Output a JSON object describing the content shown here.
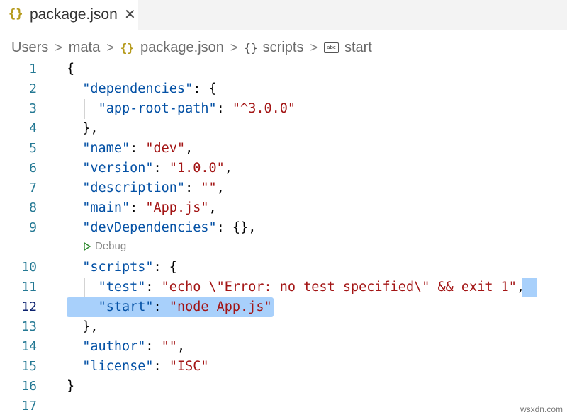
{
  "tab": {
    "label": "package.json",
    "icon": "json-braces-icon"
  },
  "breadcrumb": {
    "items": [
      "Users",
      "mata",
      "package.json",
      "scripts",
      "start"
    ]
  },
  "codelens": {
    "label": "Debug"
  },
  "lines": [
    {
      "num": "1",
      "segments": [
        [
          "p",
          "{"
        ]
      ]
    },
    {
      "num": "2",
      "segments": [
        [
          "p",
          "  "
        ],
        [
          "k",
          "\"dependencies\""
        ],
        [
          "p",
          ": {"
        ]
      ]
    },
    {
      "num": "3",
      "segments": [
        [
          "p",
          "    "
        ],
        [
          "k",
          "\"app-root-path\""
        ],
        [
          "p",
          ": "
        ],
        [
          "s",
          "\"^3.0.0\""
        ]
      ]
    },
    {
      "num": "4",
      "segments": [
        [
          "p",
          "  },"
        ]
      ]
    },
    {
      "num": "5",
      "segments": [
        [
          "p",
          "  "
        ],
        [
          "k",
          "\"name\""
        ],
        [
          "p",
          ": "
        ],
        [
          "s",
          "\"dev\""
        ],
        [
          "p",
          ","
        ]
      ]
    },
    {
      "num": "6",
      "segments": [
        [
          "p",
          "  "
        ],
        [
          "k",
          "\"version\""
        ],
        [
          "p",
          ": "
        ],
        [
          "s",
          "\"1.0.0\""
        ],
        [
          "p",
          ","
        ]
      ]
    },
    {
      "num": "7",
      "segments": [
        [
          "p",
          "  "
        ],
        [
          "k",
          "\"description\""
        ],
        [
          "p",
          ": "
        ],
        [
          "s",
          "\"\""
        ],
        [
          "p",
          ","
        ]
      ]
    },
    {
      "num": "8",
      "segments": [
        [
          "p",
          "  "
        ],
        [
          "k",
          "\"main\""
        ],
        [
          "p",
          ": "
        ],
        [
          "s",
          "\"App.js\""
        ],
        [
          "p",
          ","
        ]
      ]
    },
    {
      "num": "9",
      "segments": [
        [
          "p",
          "  "
        ],
        [
          "k",
          "\"devDependencies\""
        ],
        [
          "p",
          ": {},"
        ]
      ]
    },
    {
      "num": "10",
      "segments": [
        [
          "p",
          "  "
        ],
        [
          "k",
          "\"scripts\""
        ],
        [
          "p",
          ": {"
        ]
      ]
    },
    {
      "num": "11",
      "segments": [
        [
          "p",
          "    "
        ],
        [
          "k",
          "\"test\""
        ],
        [
          "p",
          ": "
        ],
        [
          "s",
          "\"echo \\\"Error: no test specified\\\" && exit 1\""
        ],
        [
          "p",
          ","
        ]
      ]
    },
    {
      "num": "12",
      "segments": [
        [
          "p",
          "    "
        ],
        [
          "k",
          "\"start\""
        ],
        [
          "p",
          ": "
        ],
        [
          "s",
          "\"node App.js\""
        ]
      ]
    },
    {
      "num": "13",
      "segments": [
        [
          "p",
          "  },"
        ]
      ]
    },
    {
      "num": "14",
      "segments": [
        [
          "p",
          "  "
        ],
        [
          "k",
          "\"author\""
        ],
        [
          "p",
          ": "
        ],
        [
          "s",
          "\"\""
        ],
        [
          "p",
          ","
        ]
      ]
    },
    {
      "num": "15",
      "segments": [
        [
          "p",
          "  "
        ],
        [
          "k",
          "\"license\""
        ],
        [
          "p",
          ": "
        ],
        [
          "s",
          "\"ISC\""
        ]
      ]
    },
    {
      "num": "16",
      "segments": [
        [
          "p",
          "}"
        ]
      ]
    },
    {
      "num": "17",
      "segments": []
    }
  ],
  "active_line": "12",
  "colors": {
    "key": "#0451a5",
    "string": "#a31515",
    "selection": "#a8d0fb",
    "line_number": "#237893"
  },
  "watermark": "wsxdn.com"
}
